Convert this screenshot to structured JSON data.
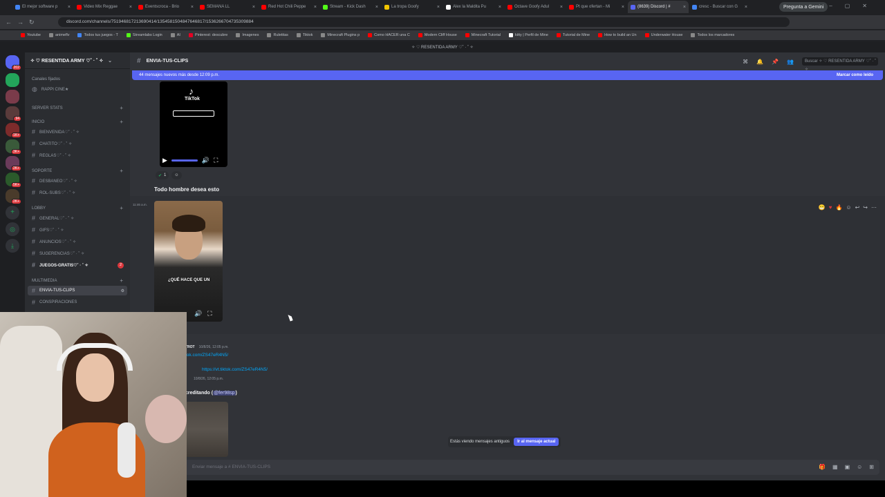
{
  "browser": {
    "tabs": [
      {
        "label": "El mejor software p",
        "color": "#4285f4",
        "active": false
      },
      {
        "label": "Video Mix Reggae",
        "color": "#ff0000",
        "active": false
      },
      {
        "label": "Eventscroca - Brio",
        "color": "#ff0000",
        "active": false
      },
      {
        "label": "SEMANA LL",
        "color": "#ff0000",
        "active": false
      },
      {
        "label": "Red Hot Chili Peppe",
        "color": "#ff0000",
        "active": false
      },
      {
        "label": "Stream - Kick Dash",
        "color": "#53fc18",
        "active": false
      },
      {
        "label": "La tropa Goofy",
        "color": "#f2c500",
        "active": false
      },
      {
        "label": "Alex la Maldita Pu",
        "color": "#ffffff",
        "active": false
      },
      {
        "label": "Octave Goofy Adul",
        "color": "#ff0000",
        "active": false
      },
      {
        "label": "Pt que ofertan - Mi",
        "color": "#ff0000",
        "active": false
      },
      {
        "label": "(8639) Discord | #",
        "color": "#5865f2",
        "active": true
      },
      {
        "label": "cresc - Buscar con G",
        "color": "#4285f4",
        "active": false
      }
    ],
    "gemini_label": "Pregunta a Gemini",
    "url": "discord.com/channels/751946817213690414/1354581504847646817/1536266704735309884",
    "bookmarks": [
      "Youtube",
      "animeflv",
      "Todos tus juegos - T",
      "Streamlabs Login",
      "AI",
      "Pinterest: descubre",
      "Imagenes",
      "Ruletitas",
      "Tiktok",
      "Minecraft Plugins p",
      "Como HACER una C",
      "Modern Cliff House",
      "Minecraft Tutorial",
      "kitty | Perfil de Mine",
      "Tutorial de Mine",
      "How to build an Un",
      "Underwater House",
      "Todos los marcadores"
    ]
  },
  "discord": {
    "window_title": "✧ ♡ RESENTIDA ARMY ♡˚ · ˚ ✧",
    "server_name": "✧ ♡ RESENTIDA ARMY ♡˚ · ˚ ✧",
    "pinned_label": "Canales fijados",
    "pinned": "RAPPI CINE★",
    "categories": {
      "stats": "SERVER STATS",
      "inicio": "INICIO",
      "soporte": "SOPORTE",
      "lobby": "LOBBY",
      "multimedia": "MULTIMEDIA"
    },
    "channels": {
      "bienvenida": "BIENVENIDA♡˚ · ˚ ✧",
      "chatito": "CHATITO♡˚ · ˚ ✧",
      "reglas": "REGLAS♡˚ · ˚ ✧",
      "desbaneo": "DESBANEO♡˚ · ˚ ✧",
      "rolsubs": "ROL-SUBS♡˚ · ˚ ✧",
      "general": "GENERAL♡˚ · ˚ ✧",
      "gifs": "GIFS♡˚ · ˚ ✧",
      "anuncios": "ANUNCIOS♡˚ · ˚ ✧",
      "sugerencias": "SUGERENCIAS♡˚ · ˚ ✧",
      "juegos": "JUEGOS-GRATIS♡˚ · ˚ ✧",
      "clips": "ENVIA-TUS-CLIPS",
      "conspiraciones": "CONSPIRACIONES"
    },
    "juegos_badge": "2",
    "server_badges": [
      "202",
      "94",
      "1K+",
      "3K+",
      "2K+",
      "5K+",
      "2K+"
    ],
    "chat": {
      "channel": "ENVIA-TUS-CLIPS",
      "search_placeholder": "Buscar ✧ ♡ RESENTIDA ARMY ♡˚ · ˚ ✧",
      "new_messages": "44 mensajes nuevos más desde 12:09 p.m.",
      "mark_read": "Marcar como leído",
      "tiktok_logo": "♪",
      "tiktok_text": "TikTok",
      "reaction_count": "1",
      "message_title": "Todo hombre desea esto",
      "timestamp": "11:46 a.m.",
      "video_subtitle": "¿QUÉ HACE QUE UN",
      "msg3_author": "TROT",
      "msg3_time": "10/8/26, 12:05 p.m.",
      "link1": "tok.com/ZS47eR4N5/",
      "link2": "https://vt.tiktok.com/ZS47eR4N5/",
      "msg4_time": "10/8/26, 12:05 p.m.",
      "msg4_text": "creditando",
      "mention": "@fer98sp",
      "old_messages": "Estás viendo mensajes antiguos",
      "jump_button": "Ir al mensaje actual",
      "composer_placeholder": "Enviar mensaje a # ENVIA-TUS-CLIPS"
    }
  }
}
